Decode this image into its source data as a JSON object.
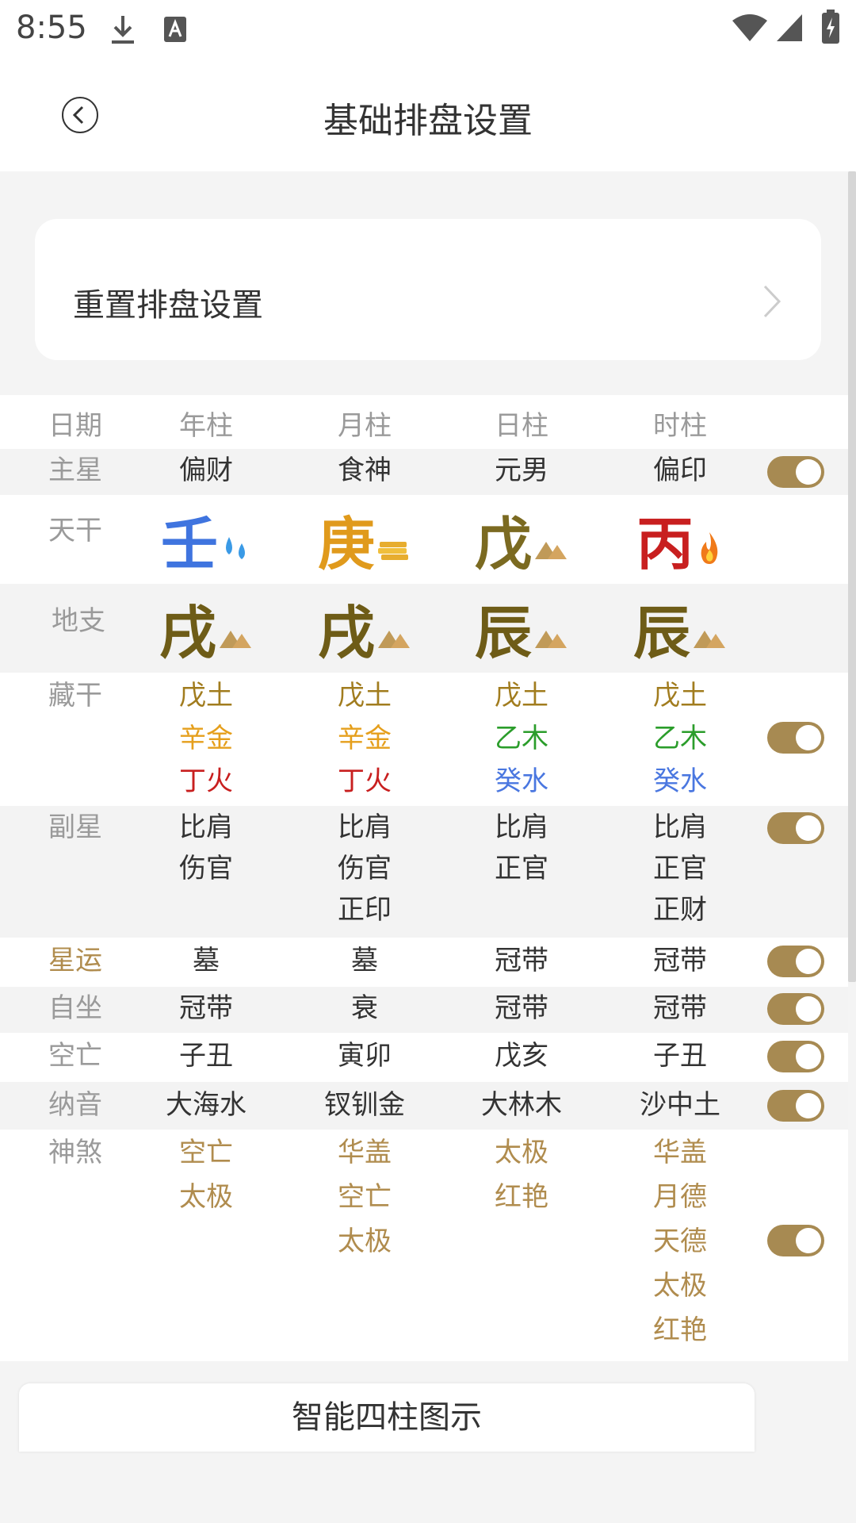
{
  "status": {
    "time": "8:55"
  },
  "header": {
    "title": "基础排盘设置"
  },
  "reset": {
    "label": "重置排盘设置"
  },
  "columns": {
    "label": "日期",
    "c1": "年柱",
    "c2": "月柱",
    "c3": "日柱",
    "c4": "时柱"
  },
  "rows": {
    "zhuxing": {
      "label": "主星",
      "c1": "偏财",
      "c2": "食神",
      "c3": "元男",
      "c4": "偏印"
    },
    "tiangan": {
      "label": "天干",
      "c1": "壬",
      "c2": "庚",
      "c3": "戊",
      "c4": "丙"
    },
    "dizhi": {
      "label": "地支",
      "c1": "戌",
      "c2": "戌",
      "c3": "辰",
      "c4": "辰"
    },
    "canggan": {
      "label": "藏干",
      "c1": [
        "戊土",
        "辛金",
        "丁火"
      ],
      "c2": [
        "戊土",
        "辛金",
        "丁火"
      ],
      "c3": [
        "戊土",
        "乙木",
        "癸水"
      ],
      "c4": [
        "戊土",
        "乙木",
        "癸水"
      ]
    },
    "fuxing": {
      "label": "副星",
      "c1": [
        "比肩",
        "伤官"
      ],
      "c2": [
        "比肩",
        "伤官",
        "正印"
      ],
      "c3": [
        "比肩",
        "正官"
      ],
      "c4": [
        "比肩",
        "正官",
        "正财"
      ]
    },
    "xingyun": {
      "label": "星运",
      "c1": "墓",
      "c2": "墓",
      "c3": "冠带",
      "c4": "冠带"
    },
    "zizuo": {
      "label": "自坐",
      "c1": "冠带",
      "c2": "衰",
      "c3": "冠带",
      "c4": "冠带"
    },
    "kongwang": {
      "label": "空亡",
      "c1": "子丑",
      "c2": "寅卯",
      "c3": "戊亥",
      "c4": "子丑"
    },
    "nayin": {
      "label": "纳音",
      "c1": "大海水",
      "c2": "钗钏金",
      "c3": "大林木",
      "c4": "沙中土"
    },
    "shensha": {
      "label": "神煞",
      "c1": [
        "空亡",
        "太极"
      ],
      "c2": [
        "华盖",
        "空亡",
        "太极"
      ],
      "c3": [
        "太极",
        "红艳"
      ],
      "c4": [
        "华盖",
        "月德",
        "天德",
        "太极",
        "红艳"
      ]
    }
  },
  "bottom": {
    "button_label": "智能四柱图示"
  },
  "colors": {
    "accent": "#a78a52",
    "earth": "#a17c1e",
    "metal": "#e59f1c",
    "fire": "#c81f1f",
    "wood": "#2b9d2b",
    "water": "#4a77e0"
  }
}
